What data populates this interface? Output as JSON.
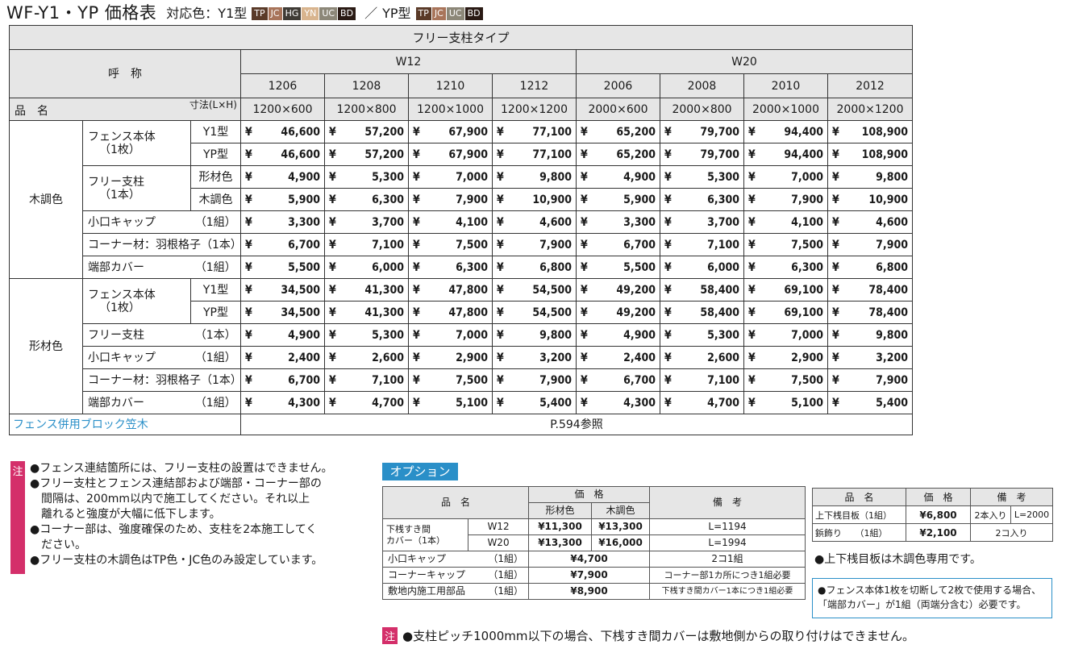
{
  "header": {
    "title": "WF-Y1・YP 価格表",
    "colors_label_y1": "対応色：Y1型",
    "colors_label_yp": "YP型",
    "slash": "／",
    "y1_badges": [
      {
        "label": "TP",
        "color": "#5a3a28"
      },
      {
        "label": "JC",
        "color": "#a8745a"
      },
      {
        "label": "HG",
        "color": "#3f3b35"
      },
      {
        "label": "YN",
        "color": "#d8b48e"
      },
      {
        "label": "UC",
        "color": "#8c8778"
      },
      {
        "label": "BD",
        "color": "#2a1a14"
      }
    ],
    "yp_badges": [
      {
        "label": "TP",
        "color": "#5a3a28"
      },
      {
        "label": "JC",
        "color": "#a8745a"
      },
      {
        "label": "UC",
        "color": "#8c8778"
      },
      {
        "label": "BD",
        "color": "#2a1a14"
      }
    ]
  },
  "table": {
    "type_title": "フリー支柱タイプ",
    "name_header": "呼　称",
    "hinmei": "品　名",
    "size_label": "寸法(L×H)",
    "groups": [
      "W12",
      "W20"
    ],
    "codes": [
      "1206",
      "1208",
      "1210",
      "1212",
      "2006",
      "2008",
      "2010",
      "2012"
    ],
    "sizes": [
      "1200×600",
      "1200×800",
      "1200×1000",
      "1200×1200",
      "2000×600",
      "2000×800",
      "2000×1000",
      "2000×1200"
    ],
    "yen": "¥",
    "wood": {
      "color": "木調色",
      "fence_body": "フェンス本体",
      "fence_qty": "（1枚）",
      "y1": "Y1型",
      "yp": "YP型",
      "free_post": "フリー支柱",
      "post_qty": "（1本）",
      "katazai": "形材色",
      "mokuchou": "木調色",
      "koguchi": "小口キャップ",
      "corner": "コーナー材：羽根格子（1本）",
      "tanbu": "端部カバー",
      "kumi": "（1組）",
      "prices_y1": [
        "46,600",
        "57,200",
        "67,900",
        "77,100",
        "65,200",
        "79,700",
        "94,400",
        "108,900"
      ],
      "prices_yp": [
        "46,600",
        "57,200",
        "67,900",
        "77,100",
        "65,200",
        "79,700",
        "94,400",
        "108,900"
      ],
      "prices_post_katazai": [
        "4,900",
        "5,300",
        "7,000",
        "9,800",
        "4,900",
        "5,300",
        "7,000",
        "9,800"
      ],
      "prices_post_mokuchou": [
        "5,900",
        "6,300",
        "7,900",
        "10,900",
        "5,900",
        "6,300",
        "7,900",
        "10,900"
      ],
      "prices_koguchi": [
        "3,300",
        "3,700",
        "4,100",
        "4,600",
        "3,300",
        "3,700",
        "4,100",
        "4,600"
      ],
      "prices_corner": [
        "6,700",
        "7,100",
        "7,500",
        "7,900",
        "6,700",
        "7,100",
        "7,500",
        "7,900"
      ],
      "prices_tanbu": [
        "5,500",
        "6,000",
        "6,300",
        "6,800",
        "5,500",
        "6,000",
        "6,300",
        "6,800"
      ]
    },
    "form": {
      "color": "形材色",
      "fence_body": "フェンス本体",
      "fence_qty": "（1枚）",
      "y1": "Y1型",
      "yp": "YP型",
      "free_post": "フリー支柱",
      "post_qty": "（1本）",
      "koguchi": "小口キャップ",
      "corner": "コーナー材：羽根格子（1本）",
      "tanbu": "端部カバー",
      "kumi": "（1組）",
      "prices_y1": [
        "34,500",
        "41,300",
        "47,800",
        "54,500",
        "49,200",
        "58,400",
        "69,100",
        "78,400"
      ],
      "prices_yp": [
        "34,500",
        "41,300",
        "47,800",
        "54,500",
        "49,200",
        "58,400",
        "69,100",
        "78,400"
      ],
      "prices_post": [
        "4,900",
        "5,300",
        "7,000",
        "9,800",
        "4,900",
        "5,300",
        "7,000",
        "9,800"
      ],
      "prices_koguchi": [
        "2,400",
        "2,600",
        "2,900",
        "3,200",
        "2,400",
        "2,600",
        "2,900",
        "3,200"
      ],
      "prices_corner": [
        "6,700",
        "7,100",
        "7,500",
        "7,900",
        "6,700",
        "7,100",
        "7,500",
        "7,900"
      ],
      "prices_tanbu": [
        "4,300",
        "4,700",
        "5,100",
        "5,400",
        "4,300",
        "4,700",
        "5,100",
        "5,400"
      ]
    },
    "block_label": "フェンス併用ブロック笠木",
    "block_ref": "P.594参照"
  },
  "notes": {
    "mark": "注",
    "items": [
      "●フェンス連結箇所には、フリー支柱の設置はできません。",
      "●フリー支柱とフェンス連結部および端部・コーナー部の\n間隔は、200mm以内で施工してください。それ以上\n離れると強度が大幅に低下します。",
      "●コーナー部は、強度確保のため、支柱を2本施工してく\nださい。",
      "●フリー支柱の木調色はTP色・JC色のみ設定しています。"
    ]
  },
  "options": {
    "title": "オプション",
    "h_name": "品　名",
    "h_price": "価　格",
    "h_katazai": "形材色",
    "h_mokuchou": "木調色",
    "h_biko": "備　考",
    "cover_label": "下桟すき間\nカバー（1本）",
    "cover_w12": "W12",
    "cover_w20": "W20",
    "cover_w12_katazai": "¥11,300",
    "cover_w12_mokuchou": "¥13,300",
    "cover_w12_biko": "L=1194",
    "cover_w20_katazai": "¥13,300",
    "cover_w20_mokuchou": "¥16,000",
    "cover_w20_biko": "L=1994",
    "koguchi": "小口キャップ",
    "koguchi_qty": "（1組）",
    "koguchi_price": "¥4,700",
    "koguchi_biko": "2コ1組",
    "corner": "コーナーキャップ",
    "corner_qty": "（1組）",
    "corner_price": "¥7,900",
    "corner_biko": "コーナー部1カ所につき1組必要",
    "shikichi": "敷地内施工用部品",
    "shikichi_qty": "（1組）",
    "shikichi_price": "¥8,900",
    "shikichi_biko": "下桟すき間カバー1本につき1組必要"
  },
  "side": {
    "h_name": "品　名",
    "h_price": "価　格",
    "h_biko": "備　考",
    "r1_name": "上下桟目板（1組）",
    "r1_price": "¥6,800",
    "r1_biko1": "2本入り",
    "r1_biko2": "L=2000",
    "r2_name": "鋲飾り　　（1組）",
    "r2_price": "¥2,100",
    "r2_biko": "2コ入り",
    "note": "●上下桟目板は木調色専用です。",
    "box_note": "●フェンス本体1枚を切断して2枚で使用する場合、\n「端部カバー」が1組（両端分含む）必要です。"
  },
  "bottom_note": {
    "mark": "注",
    "text": "●支柱ピッチ1000mm以下の場合、下桟すき間カバーは敷地側からの取り付けはできません。"
  }
}
